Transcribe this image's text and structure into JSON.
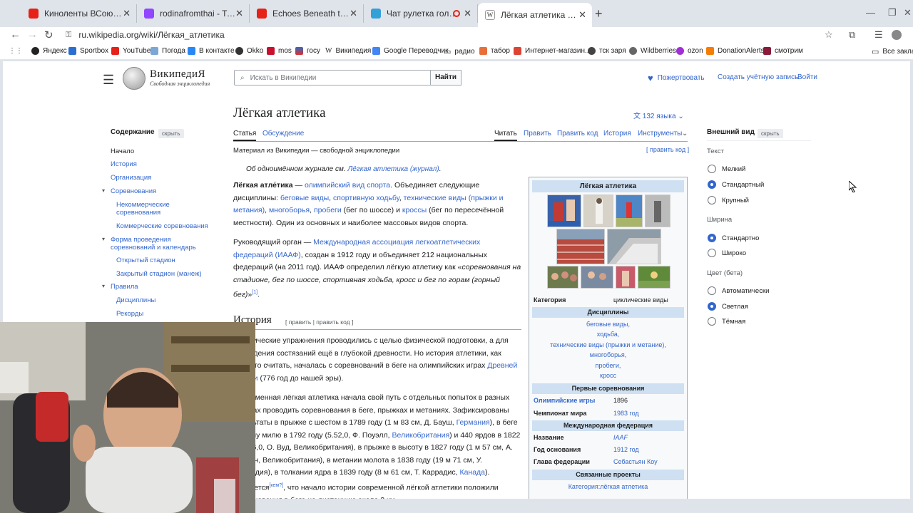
{
  "browser": {
    "tabs": [
      {
        "title": "Киноленты ВСоюзе — смотре",
        "color": "#e62117"
      },
      {
        "title": "rodinafromthai - Twitch",
        "color": "#9146ff"
      },
      {
        "title": "Echoes Beneath the Moss Org",
        "color": "#e62117"
      },
      {
        "title": "Чат рулетка голосовая —",
        "color": "#34a0d8"
      },
      {
        "title": "Лёгкая атлетика — Википедия",
        "color": "#ffffff"
      }
    ],
    "url": "ru.wikipedia.org/wiki/Лёгкая_атлетика",
    "bookmarks": [
      "Яндекс",
      "Sportbox",
      "YouTube",
      "Погода",
      "В контакте",
      "Okko",
      "mos",
      "госу",
      "Википедия",
      "Google Переводчик",
      "радио",
      "табор",
      "Интернет-магазин...",
      "тск заря",
      "Wildberries",
      "ozon",
      "DonationAlerts",
      "смотрим"
    ],
    "bookmarks_other": "Все закладки"
  },
  "wiki": {
    "wordmark": "ВикипедиЯ",
    "tagline": "Свободная энциклопедия",
    "search_placeholder": "Искать в Википедии",
    "search_button": "Найти",
    "donate": "Пожертвовать",
    "create_account": "Создать учётную запись",
    "login": "Войти",
    "toc": {
      "title": "Содержание",
      "hide": "скрыть",
      "items": [
        "Начало",
        "История",
        "Организация",
        "Соревнования",
        "Некоммерческие соревнования",
        "Коммерческие соревнования",
        "Форма проведения соревнований и календарь",
        "Открытый стадион",
        "Закрытый стадион (манеж)",
        "Правила",
        "Дисциплины",
        "Рекорды"
      ]
    },
    "title": "Лёгкая атлетика",
    "languages": "132 языка",
    "tabs": {
      "article": "Статья",
      "talk": "Обсуждение",
      "read": "Читать",
      "edit": "Править",
      "edit_source": "Править код",
      "history": "История",
      "tools": "Инструменты"
    },
    "site_sub": "Материал из Википедии — свободной энциклопедии",
    "edit_code_link": "[ править код ]",
    "hatnote_text": "Об одноимённом журнале см.",
    "hatnote_link": "Лёгкая атлетика (журнал)",
    "section_heading": "История",
    "section_edit": "[ править | править код ]"
  },
  "infobox": {
    "title": "Лёгкая атлетика",
    "category_label": "Категория",
    "category_value": "циклические виды",
    "disciplines_head": "Дисциплины",
    "disciplines": [
      "беговые виды,",
      "ходьба,",
      "технические виды (прыжки и метание),",
      "многоборья,",
      "пробеги,",
      "кросс"
    ],
    "first_comp_head": "Первые соревнования",
    "olympics_label": "Олимпийские игры",
    "olympics_value": "1896",
    "worlds_label": "Чемпионат мира",
    "worlds_value": "1983 год",
    "fed_head": "Международная федерация",
    "name_label": "Название",
    "name_value": "IAAF",
    "year_label": "Год основания",
    "year_value": "1912 год",
    "head_label": "Глава федерации",
    "head_value": "Себастьян Коу",
    "related_head": "Связанные проекты",
    "related_link": "Категория:лёгкая атлетика"
  },
  "appearance": {
    "title": "Внешний вид",
    "hide": "скрыть",
    "text_label": "Текст",
    "text_options": [
      "Мелкий",
      "Стандартный",
      "Крупный"
    ],
    "width_label": "Ширина",
    "width_options": [
      "Стандартно",
      "Широко"
    ],
    "color_label": "Цвет (бета)",
    "color_options": [
      "Автоматически",
      "Светлая",
      "Тёмная"
    ]
  }
}
